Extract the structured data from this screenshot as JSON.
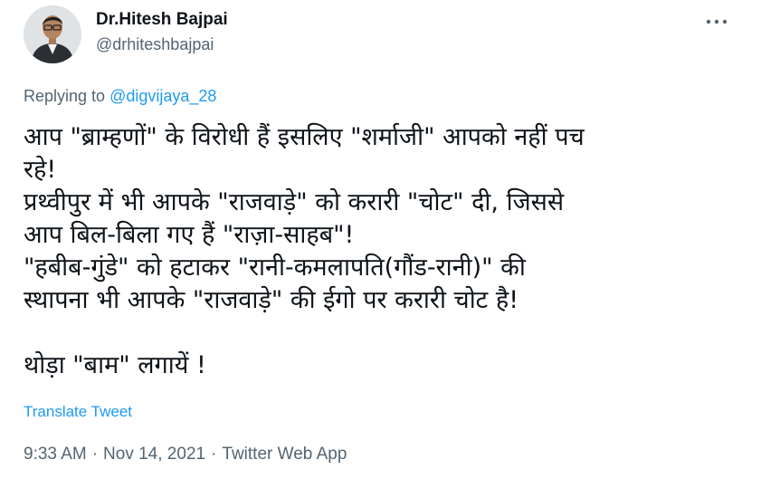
{
  "author": {
    "display_name": "Dr.Hitesh Bajpai",
    "handle": "@drhiteshbajpai"
  },
  "replying": {
    "prefix": "Replying to",
    "mention": "@digvijaya_28"
  },
  "tweet": {
    "text": "आप \"ब्राम्हणों\" के विरोधी हैं इसलिए \"शर्माजी\" आपको नहीं पच\nरहे!\nप्रथ्वीपुर में भी आपके \"राजवाड़े\" को करारी \"चोट\" दी, जिससे\nआप बिल-बिला गए हैं \"राज़ा-साहब\"!\n\"हबीब-गुंडे\" को हटाकर \"रानी-कमलापति(गौंड-रानी)\" की\nस्थापना भी आपके \"राजवाड़े\" की ईगो पर करारी चोट है!\n\nथोड़ा \"बाम\" लगायें !",
    "translate_label": "Translate Tweet"
  },
  "meta": {
    "time": "9:33 AM",
    "separator": "·",
    "date": "Nov 14, 2021",
    "source": "Twitter Web App"
  },
  "colors": {
    "accent": "#1d9bf0",
    "secondary_text": "#536471",
    "primary_text": "#0f1419"
  },
  "icons": {
    "more": "more-horizontal-icon"
  }
}
